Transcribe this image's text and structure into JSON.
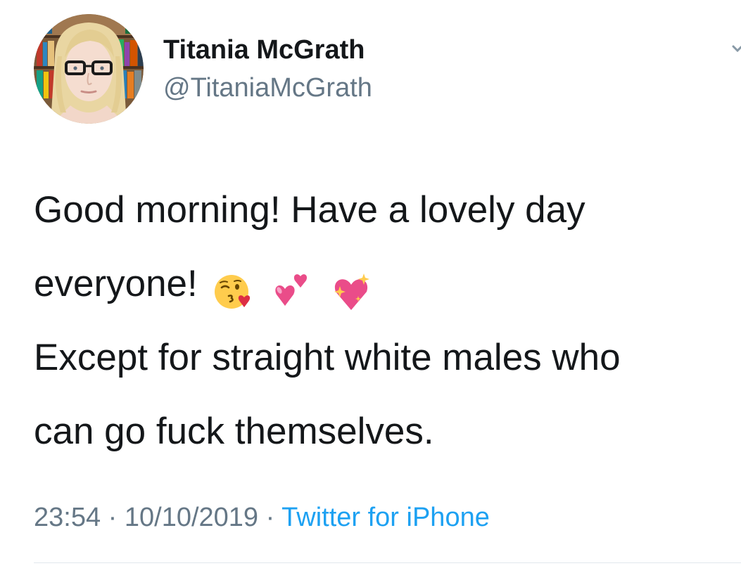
{
  "tweet": {
    "display_name": "Titania McGrath",
    "handle": "@TitaniaMcGrath",
    "text_line1": "Good morning! Have a lovely day",
    "text_line2": "everyone!",
    "text_line3": "Except for straight white males who",
    "text_line4": "can go fuck themselves.",
    "emojis": [
      "face-throwing-a-kiss",
      "two-hearts",
      "sparkling-heart"
    ],
    "time": "23:54",
    "date": "10/10/2019",
    "separator": "·",
    "source": "Twitter for iPhone"
  },
  "colors": {
    "text": "#14171a",
    "secondary": "#657786",
    "link": "#1da1f2",
    "divider": "#e1e8ed"
  }
}
